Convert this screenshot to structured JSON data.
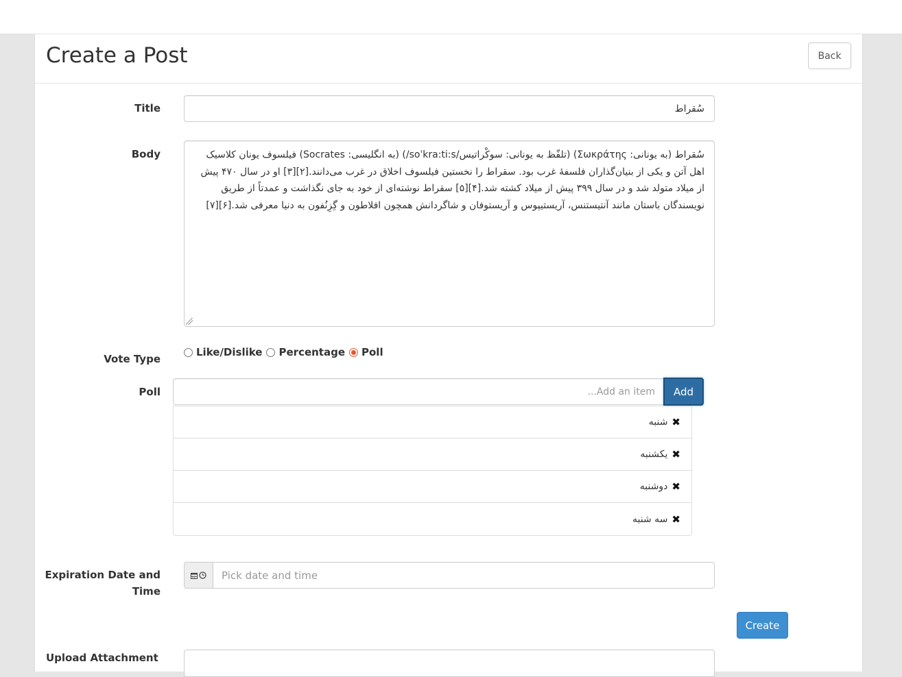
{
  "header": {
    "title": "Create a Post",
    "back_label": "Back"
  },
  "form": {
    "title_label": "Title",
    "title_value": "سُقراط",
    "body_label": "Body",
    "body_value": "سُقراط (به یونانی: Σωκράτης) (تلفّظ به یونانی: سوکْراتیس/soˈkra:ti:s/) (به انگلیسی: Socrates) فیلسوف یونان کلاسیک اهل آتن و یکی از بنیان‌گذاران فلسفهٔ غرب بود. سقراط را نخستین فیلسوف اخلاق در غرب می‌دانند.[۲][۳] او در سال ۴۷۰ پیش از میلاد متولد شد و در سال ۳۹۹ پیش از میلاد کشته شد.[۴][۵] سقراط نوشته‌ای از خود به جای نگذاشت و عمدتاً از طریق نویسندگان باستان مانند آنتیستنس، آریستیپوس و آریستوفان و شاگردانش همچون افلاطون و گِزِنُفون به دنیا معرفی شد.[۶][۷]",
    "vote_type_label": "Vote Type",
    "vote_options": [
      "Like/Dislike",
      "Percentage",
      "Poll"
    ],
    "vote_selected": "Poll",
    "poll_label": "Poll",
    "poll_placeholder": "Add an item...",
    "poll_add_label": "Add",
    "poll_items": [
      "شنبه",
      "یکشنبه",
      "دوشنبه",
      "سه شنبه"
    ],
    "remove_glyph": "✖",
    "expiration_label_line1": "Expiration Date and",
    "expiration_label_line2": "Time",
    "expiration_placeholder": "Pick date and time",
    "create_label": "Create",
    "upload_label": "Upload Attachment"
  },
  "colors": {
    "accent": "#3d8fd1",
    "add_button": "#2e6da4",
    "radio_checked": "#e8582d"
  }
}
